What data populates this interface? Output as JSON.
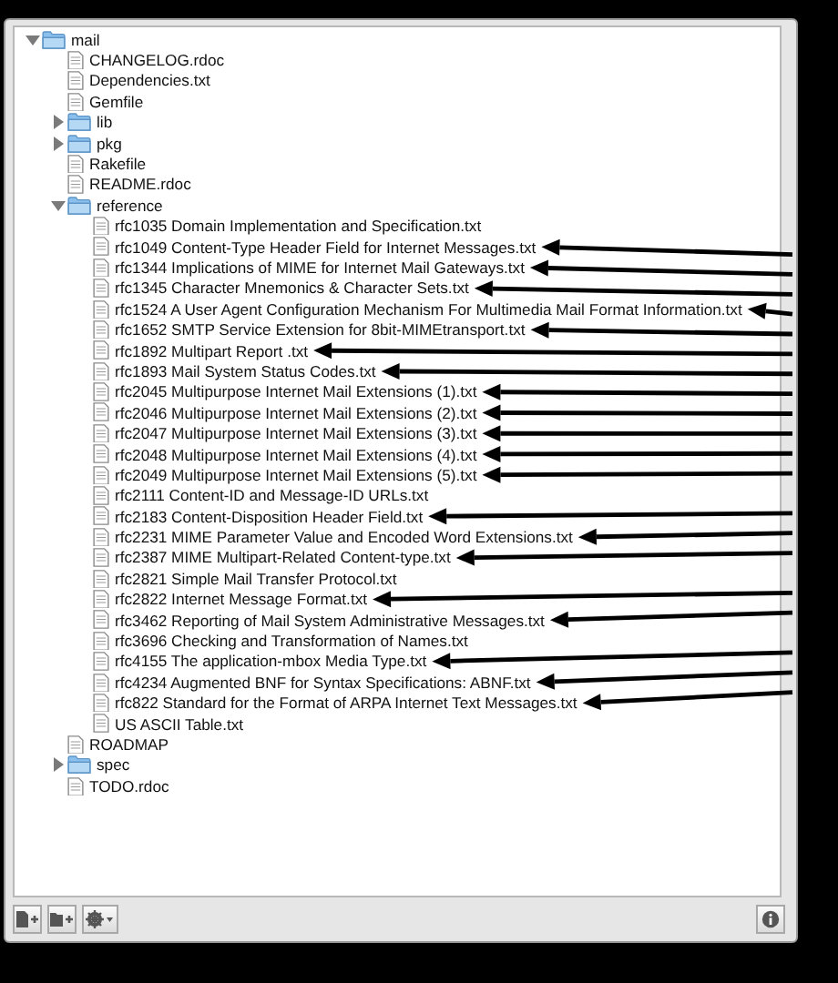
{
  "tree": [
    {
      "name": "mail",
      "kind": "folder",
      "expanded": true,
      "children": [
        {
          "name": "CHANGELOG.rdoc",
          "kind": "file"
        },
        {
          "name": "Dependencies.txt",
          "kind": "file"
        },
        {
          "name": "Gemfile",
          "kind": "file"
        },
        {
          "name": "lib",
          "kind": "folder",
          "expanded": false
        },
        {
          "name": "pkg",
          "kind": "folder",
          "expanded": false
        },
        {
          "name": "Rakefile",
          "kind": "file"
        },
        {
          "name": "README.rdoc",
          "kind": "file"
        },
        {
          "name": "reference",
          "kind": "folder",
          "expanded": true,
          "children": [
            {
              "name": "rfc1035 Domain Implementation and Specification.txt",
              "kind": "file",
              "pointed": false
            },
            {
              "name": "rfc1049 Content-Type Header Field for Internet Messages.txt",
              "kind": "file",
              "pointed": true
            },
            {
              "name": "rfc1344 Implications of MIME for Internet Mail Gateways.txt",
              "kind": "file",
              "pointed": true
            },
            {
              "name": "rfc1345 Character Mnemonics & Character Sets.txt",
              "kind": "file",
              "pointed": true
            },
            {
              "name": "rfc1524 A User Agent Configuration Mechanism For Multimedia Mail Format Information.txt",
              "kind": "file",
              "pointed": true
            },
            {
              "name": "rfc1652 SMTP Service Extension for 8bit-MIMEtransport.txt",
              "kind": "file",
              "pointed": true
            },
            {
              "name": "rfc1892 Multipart Report .txt",
              "kind": "file",
              "pointed": true
            },
            {
              "name": "rfc1893 Mail System Status Codes.txt",
              "kind": "file",
              "pointed": true
            },
            {
              "name": "rfc2045 Multipurpose Internet Mail Extensions (1).txt",
              "kind": "file",
              "pointed": true
            },
            {
              "name": "rfc2046 Multipurpose Internet Mail Extensions (2).txt",
              "kind": "file",
              "pointed": true
            },
            {
              "name": "rfc2047 Multipurpose Internet Mail Extensions (3).txt",
              "kind": "file",
              "pointed": true
            },
            {
              "name": "rfc2048 Multipurpose Internet Mail Extensions (4).txt",
              "kind": "file",
              "pointed": true
            },
            {
              "name": "rfc2049 Multipurpose Internet Mail Extensions (5).txt",
              "kind": "file",
              "pointed": true
            },
            {
              "name": "rfc2111 Content-ID and Message-ID URLs.txt",
              "kind": "file",
              "pointed": false
            },
            {
              "name": "rfc2183 Content-Disposition Header Field.txt",
              "kind": "file",
              "pointed": true
            },
            {
              "name": "rfc2231 MIME Parameter Value and Encoded Word Extensions.txt",
              "kind": "file",
              "pointed": true
            },
            {
              "name": "rfc2387 MIME Multipart-Related Content-type.txt",
              "kind": "file",
              "pointed": true
            },
            {
              "name": "rfc2821 Simple Mail Transfer Protocol.txt",
              "kind": "file",
              "pointed": false
            },
            {
              "name": "rfc2822 Internet Message Format.txt",
              "kind": "file",
              "pointed": true
            },
            {
              "name": "rfc3462 Reporting of Mail System Administrative Messages.txt",
              "kind": "file",
              "pointed": true
            },
            {
              "name": "rfc3696 Checking and Transformation of Names.txt",
              "kind": "file",
              "pointed": false
            },
            {
              "name": "rfc4155 The application-mbox Media Type.txt",
              "kind": "file",
              "pointed": true
            },
            {
              "name": "rfc4234 Augmented BNF for Syntax Specifications: ABNF.txt",
              "kind": "file",
              "pointed": true
            },
            {
              "name": "rfc822 Standard for the Format of ARPA Internet Text Messages.txt",
              "kind": "file",
              "pointed": true
            },
            {
              "name": "US ASCII Table.txt",
              "kind": "file",
              "pointed": false
            }
          ]
        },
        {
          "name": "ROADMAP",
          "kind": "file"
        },
        {
          "name": "spec",
          "kind": "folder",
          "expanded": false
        },
        {
          "name": "TODO.rdoc",
          "kind": "file"
        }
      ]
    }
  ]
}
